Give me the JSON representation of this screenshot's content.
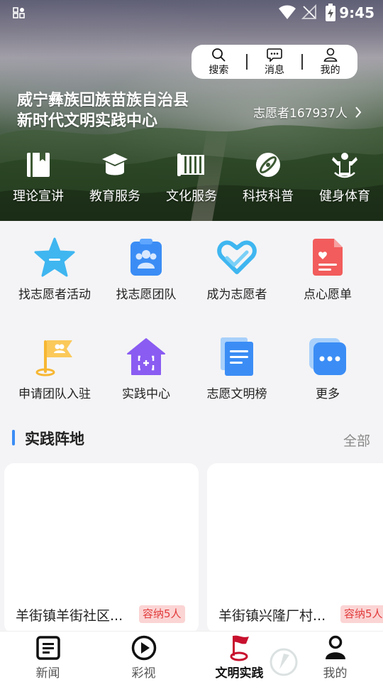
{
  "status_bar": {
    "time": "9:45",
    "icons": [
      "notification-icon",
      "wifi-icon",
      "no-signal-icon",
      "battery-charging-icon"
    ]
  },
  "header": {
    "actions": [
      {
        "label": "搜索",
        "icon": "search-icon"
      },
      {
        "label": "消息",
        "icon": "message-icon"
      },
      {
        "label": "我的",
        "icon": "user-icon"
      }
    ],
    "title_line1": "威宁彝族回族苗族自治县",
    "title_line2": "新时代文明实践中心",
    "volunteer_count": "志愿者167937人"
  },
  "hero_nav": [
    {
      "label": "理论宣讲",
      "icon": "book-icon"
    },
    {
      "label": "教育服务",
      "icon": "graduation-cap-icon"
    },
    {
      "label": "文化服务",
      "icon": "scroll-icon"
    },
    {
      "label": "科技科普",
      "icon": "atom-icon"
    },
    {
      "label": "健身体育",
      "icon": "fitness-icon"
    }
  ],
  "grid": [
    {
      "label": "找志愿者活动",
      "icon": "star-icon",
      "color": "#3fb6f0"
    },
    {
      "label": "找志愿团队",
      "icon": "team-clipboard-icon",
      "color": "#3b8df5"
    },
    {
      "label": "成为志愿者",
      "icon": "heart-hand-icon",
      "color": "#3fb6f0"
    },
    {
      "label": "点心愿单",
      "icon": "wish-document-icon",
      "color": "#f25c5c"
    },
    {
      "label": "申请团队入驻",
      "icon": "flag-icon",
      "color": "#f7b733"
    },
    {
      "label": "实践中心",
      "icon": "house-icon",
      "color": "#8a5cf2"
    },
    {
      "label": "志愿文明榜",
      "icon": "document-icon",
      "color": "#3b8df5"
    },
    {
      "label": "更多",
      "icon": "more-icon",
      "color": "#3b8df5"
    }
  ],
  "section": {
    "title": "实践阵地",
    "all_label": "全部"
  },
  "cards": [
    {
      "name": "羊街镇羊街社区...",
      "capacity": "容纳5人"
    },
    {
      "name": "羊街镇兴隆厂村...",
      "capacity": "容纳5人"
    }
  ],
  "bottom_nav": [
    {
      "label": "新闻",
      "icon": "news-icon",
      "active": false
    },
    {
      "label": "彩视",
      "icon": "play-icon",
      "active": false
    },
    {
      "label": "文明实践",
      "icon": "civilization-flag-icon",
      "active": true
    },
    {
      "label": "我的",
      "icon": "user-icon",
      "active": false
    }
  ],
  "colors": {
    "accent": "#3b8df5",
    "capacity_bg": "#fbd4d4",
    "capacity_text": "#e23b3b",
    "active_tab_icon": "#c8102e"
  }
}
